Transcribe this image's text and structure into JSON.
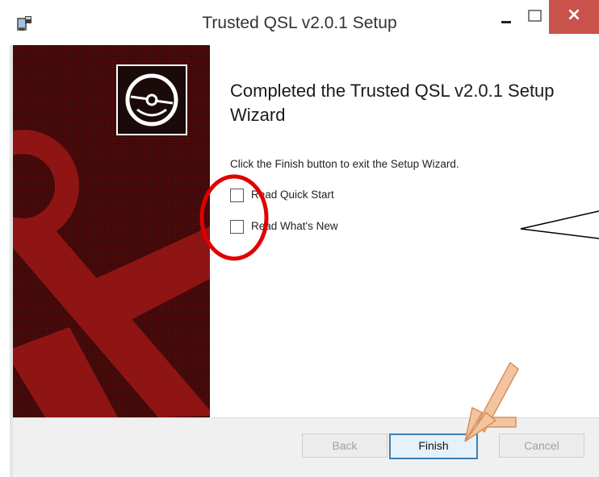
{
  "window": {
    "title": "Trusted QSL v2.0.1 Setup",
    "close_glyph": "×",
    "icons": [
      "installer-icon",
      "minimize-icon",
      "maximize-icon",
      "close-icon"
    ]
  },
  "banner": {
    "icon": "disc-icon",
    "colors": {
      "background": "#4a0b0b",
      "anchor": "#9a1515"
    }
  },
  "main": {
    "heading": "Completed the Trusted QSL v2.0.1 Setup Wizard",
    "description": "Click the Finish button to exit the Setup Wizard.",
    "checkboxes": [
      {
        "label": "Read Quick Start",
        "checked": false
      },
      {
        "label": "Read What's New",
        "checked": false
      }
    ]
  },
  "buttons": {
    "back": "Back",
    "finish": "Finish",
    "cancel": "Cancel"
  },
  "annotations": {
    "highlight_color": "#e00000",
    "arrow_color": "#e8a070"
  }
}
